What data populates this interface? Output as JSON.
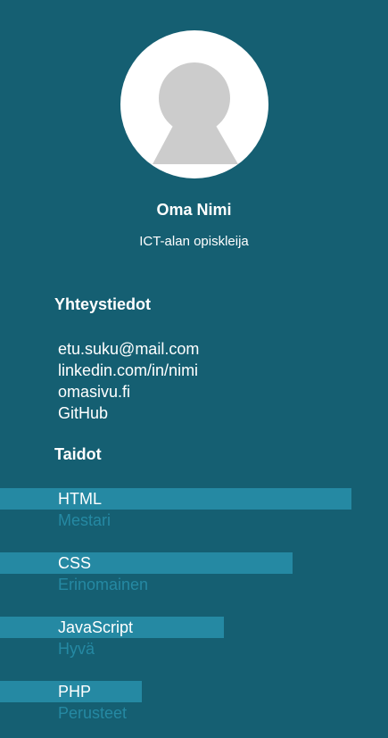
{
  "profile": {
    "name": "Oma Nimi",
    "role": "ICT-alan opiskleija"
  },
  "contact": {
    "title": "Yhteystiedot",
    "items": [
      "etu.suku@mail.com",
      "linkedin.com/in/nimi",
      "omasivu.fi",
      "GitHub"
    ]
  },
  "skills": {
    "title": "Taidot",
    "items": [
      {
        "name": "HTML",
        "level": "Mestari",
        "fill_percent": 90.5
      },
      {
        "name": "CSS",
        "level": "Erinomainen",
        "fill_percent": 75.4
      },
      {
        "name": "JavaScript",
        "level": "Hyvä",
        "fill_percent": 57.7
      },
      {
        "name": "PHP",
        "level": "Perusteet",
        "fill_percent": 36.6
      }
    ]
  },
  "colors": {
    "background": "#155f72",
    "bar": "#2589a3",
    "avatar_bg": "#ffffff",
    "avatar_silhouette": "#cccccc"
  }
}
